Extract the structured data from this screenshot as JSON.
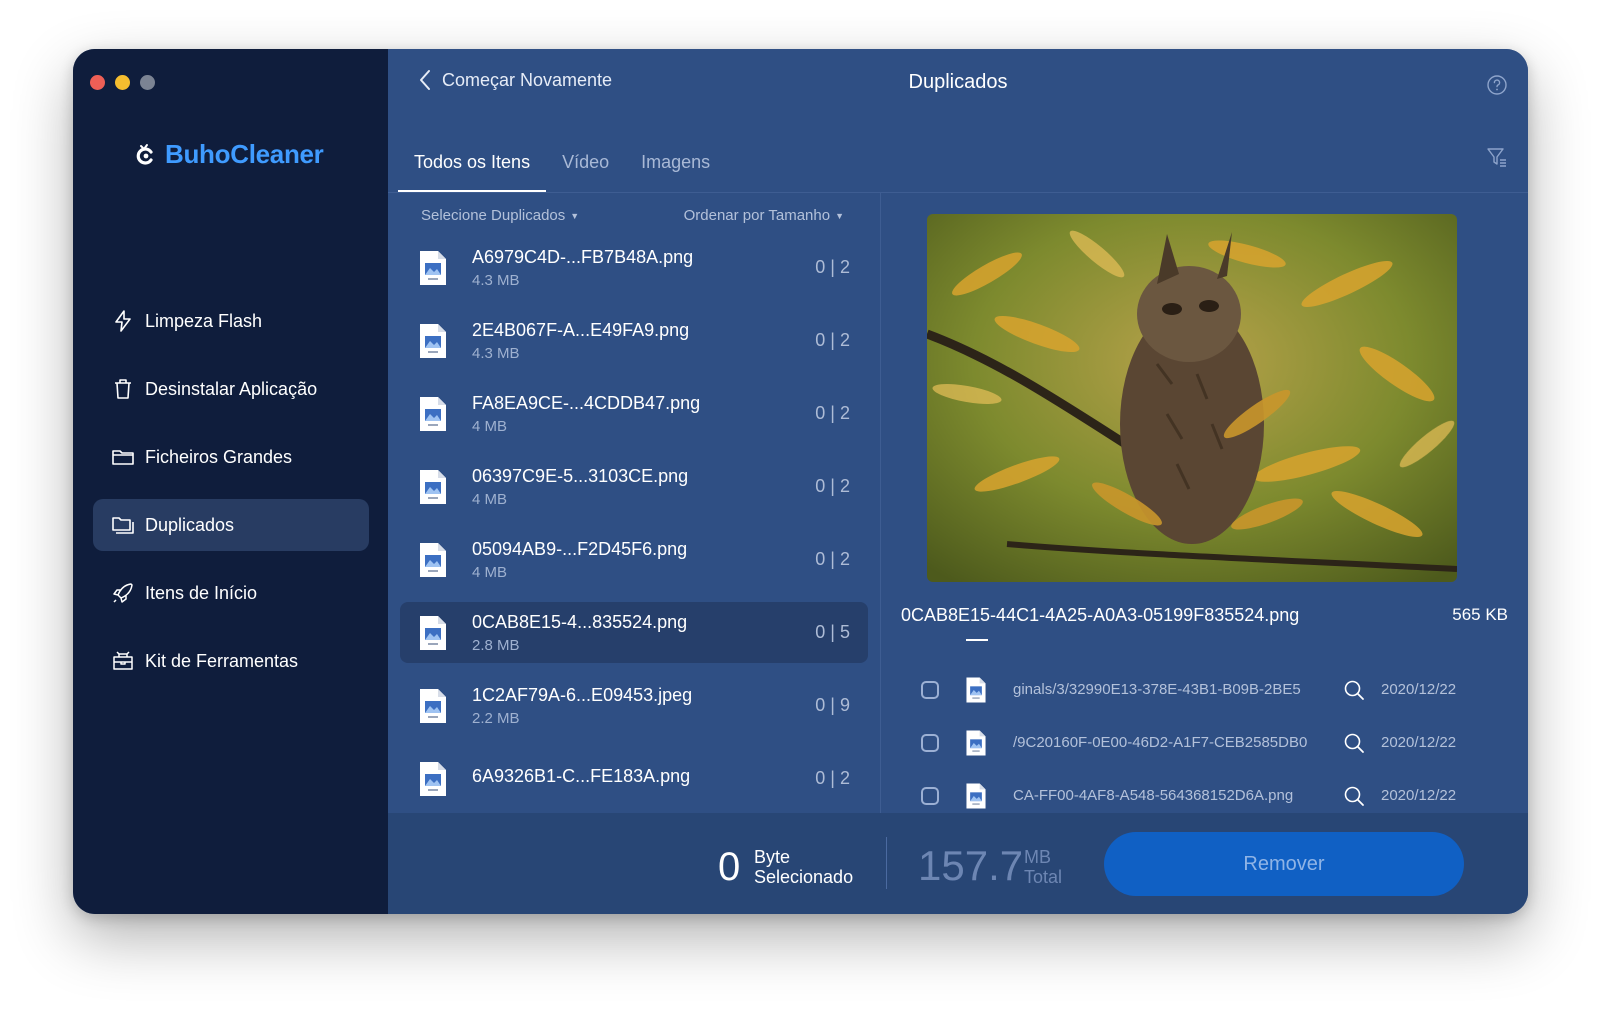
{
  "app": {
    "name": "BuhoCleaner"
  },
  "sidebar": {
    "items": [
      {
        "label": "Limpeza Flash",
        "icon": "flash-icon"
      },
      {
        "label": "Desinstalar Aplicação",
        "icon": "trash-icon"
      },
      {
        "label": "Ficheiros Grandes",
        "icon": "folder-icon"
      },
      {
        "label": "Duplicados",
        "icon": "duplicate-folder-icon",
        "active": true
      },
      {
        "label": "Itens de Início",
        "icon": "rocket-icon"
      },
      {
        "label": "Kit de Ferramentas",
        "icon": "toolbox-icon"
      }
    ]
  },
  "header": {
    "back_label": "Começar Novamente",
    "title": "Duplicados"
  },
  "tabs": [
    {
      "label": "Todos os Itens",
      "active": true
    },
    {
      "label": "Vídeo"
    },
    {
      "label": "Imagens"
    }
  ],
  "list_controls": {
    "select_label": "Selecione Duplicados",
    "sort_label": "Ordenar por Tamanho"
  },
  "files": [
    {
      "name": "A6979C4D-...FB7B48A.png",
      "size": "4.3 MB",
      "count": "0 | 2"
    },
    {
      "name": "2E4B067F-A...E49FA9.png",
      "size": "4.3 MB",
      "count": "0 | 2"
    },
    {
      "name": "FA8EA9CE-...4CDDB47.png",
      "size": "4 MB",
      "count": "0 | 2"
    },
    {
      "name": "06397C9E-5...3103CE.png",
      "size": "4 MB",
      "count": "0 | 2"
    },
    {
      "name": "05094AB9-...F2D45F6.png",
      "size": "4 MB",
      "count": "0 | 2"
    },
    {
      "name": "0CAB8E15-4...835524.png",
      "size": "2.8 MB",
      "count": "0 | 5",
      "selected": true
    },
    {
      "name": "1C2AF79A-6...E09453.jpeg",
      "size": "2.2 MB",
      "count": "0 | 9"
    },
    {
      "name": "6A9326B1-C...FE183A.png",
      "size": "",
      "count": "0 | 2"
    }
  ],
  "detail": {
    "file_name": "0CAB8E15-44C1-4A25-A0A3-05199F835524.png",
    "file_size": "565 KB",
    "paths": [
      {
        "path": "ginals/3/32990E13-378E-43B1-B09B-2BE5",
        "date": "2020/12/22"
      },
      {
        "path": "/9C20160F-0E00-46D2-A1F7-CEB2585DB0",
        "date": "2020/12/22"
      },
      {
        "path": "CA-FF00-4AF8-A548-564368152D6A.png",
        "date": "2020/12/22"
      }
    ]
  },
  "footer": {
    "selected_value": "0",
    "selected_unit": "Byte",
    "selected_label": "Selecionado",
    "total_value": "157.7",
    "total_unit": "MB",
    "total_label": "Total",
    "remove_label": "Remover"
  },
  "colors": {
    "sidebar_bg": "#0f1d3c",
    "main_bg": "#2f4f84",
    "accent": "#3f9bff",
    "button": "#1060c4"
  }
}
